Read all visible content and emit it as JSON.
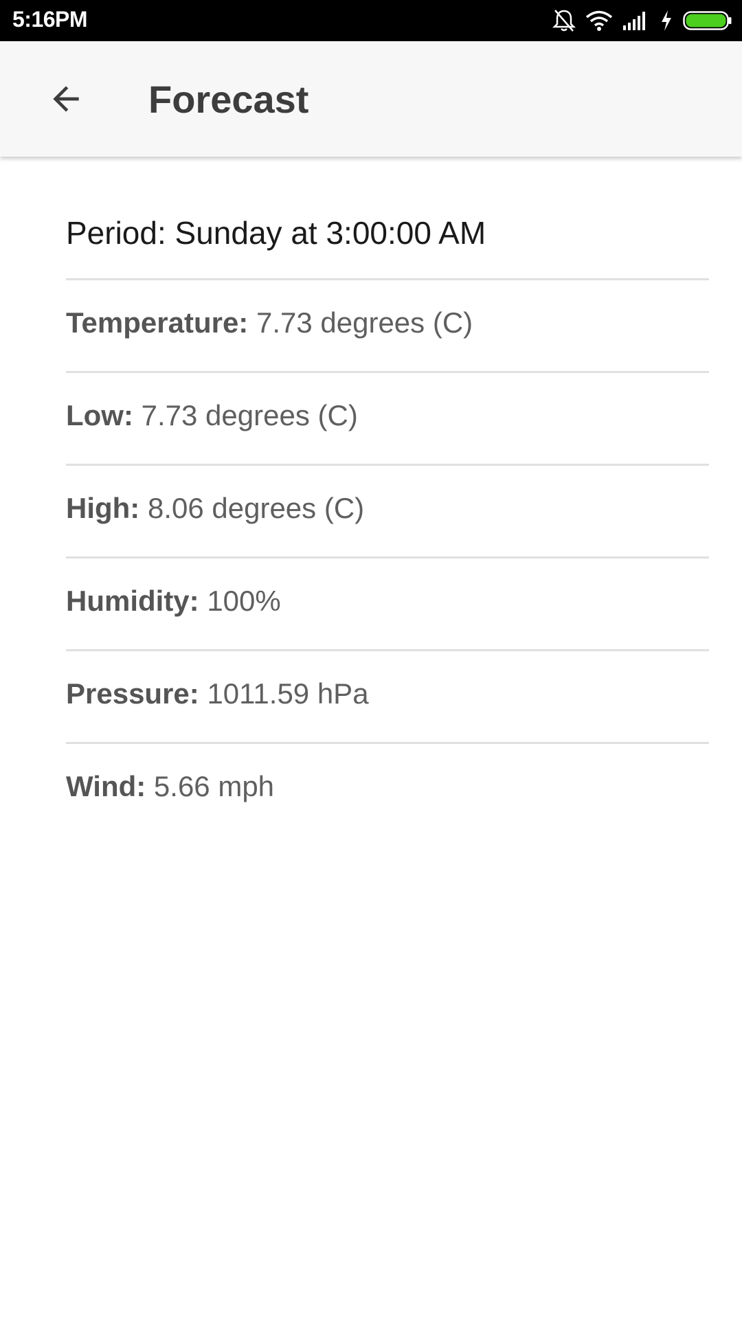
{
  "status_bar": {
    "time": "5:16PM",
    "icons": [
      "bell-off-icon",
      "wifi-icon",
      "signal-icon",
      "charging-bolt-icon",
      "battery-icon"
    ],
    "battery_color": "#4ccf1f"
  },
  "app_bar": {
    "back_icon": "arrow-back-icon",
    "title": "Forecast"
  },
  "forecast": {
    "period": "Period: Sunday at 3:00:00 AM",
    "details": [
      {
        "label": "Temperature:",
        "value": "7.73 degrees (C)"
      },
      {
        "label": "Low:",
        "value": "7.73 degrees (C)"
      },
      {
        "label": "High:",
        "value": "8.06 degrees (C)"
      },
      {
        "label": "Humidity:",
        "value": "100%"
      },
      {
        "label": "Pressure:",
        "value": "1011.59 hPa"
      },
      {
        "label": "Wind:",
        "value": "5.66 mph"
      }
    ]
  }
}
